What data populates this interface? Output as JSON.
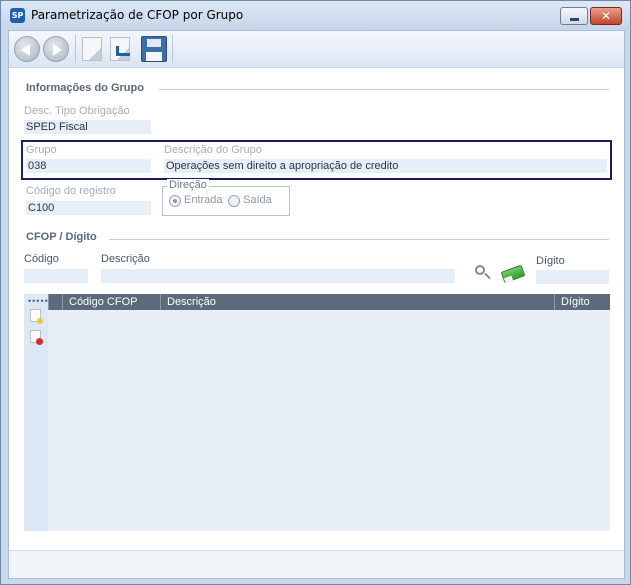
{
  "window": {
    "title": "Parametrização de CFOP por Grupo",
    "app_icon_text": "SP"
  },
  "section_group": {
    "title": "Informações do Grupo",
    "desc_tipo_label": "Desc. Tipo Obrigação",
    "desc_tipo_value": "SPED Fiscal",
    "grupo_label": "Grupo",
    "grupo_value": "038",
    "descricao_grupo_label": "Descrição do Grupo",
    "descricao_grupo_value": "Operações sem direito a apropriação de credito",
    "codigo_registro_label": "Código do registro",
    "codigo_registro_value": "C100",
    "direcao": {
      "legend": "Direção",
      "options": [
        "Entrada",
        "Saída"
      ],
      "selected": "Entrada"
    }
  },
  "section_cfop": {
    "title": "CFOP / Dígito",
    "codigo_label": "Código",
    "codigo_value": "",
    "descricao_label": "Descrição",
    "descricao_value": "",
    "digito_label": "Dígito",
    "digito_value": ""
  },
  "grid": {
    "dots": "•••••",
    "columns": [
      "Código CFOP",
      "Descrição",
      "Dígito"
    ],
    "rows": []
  }
}
